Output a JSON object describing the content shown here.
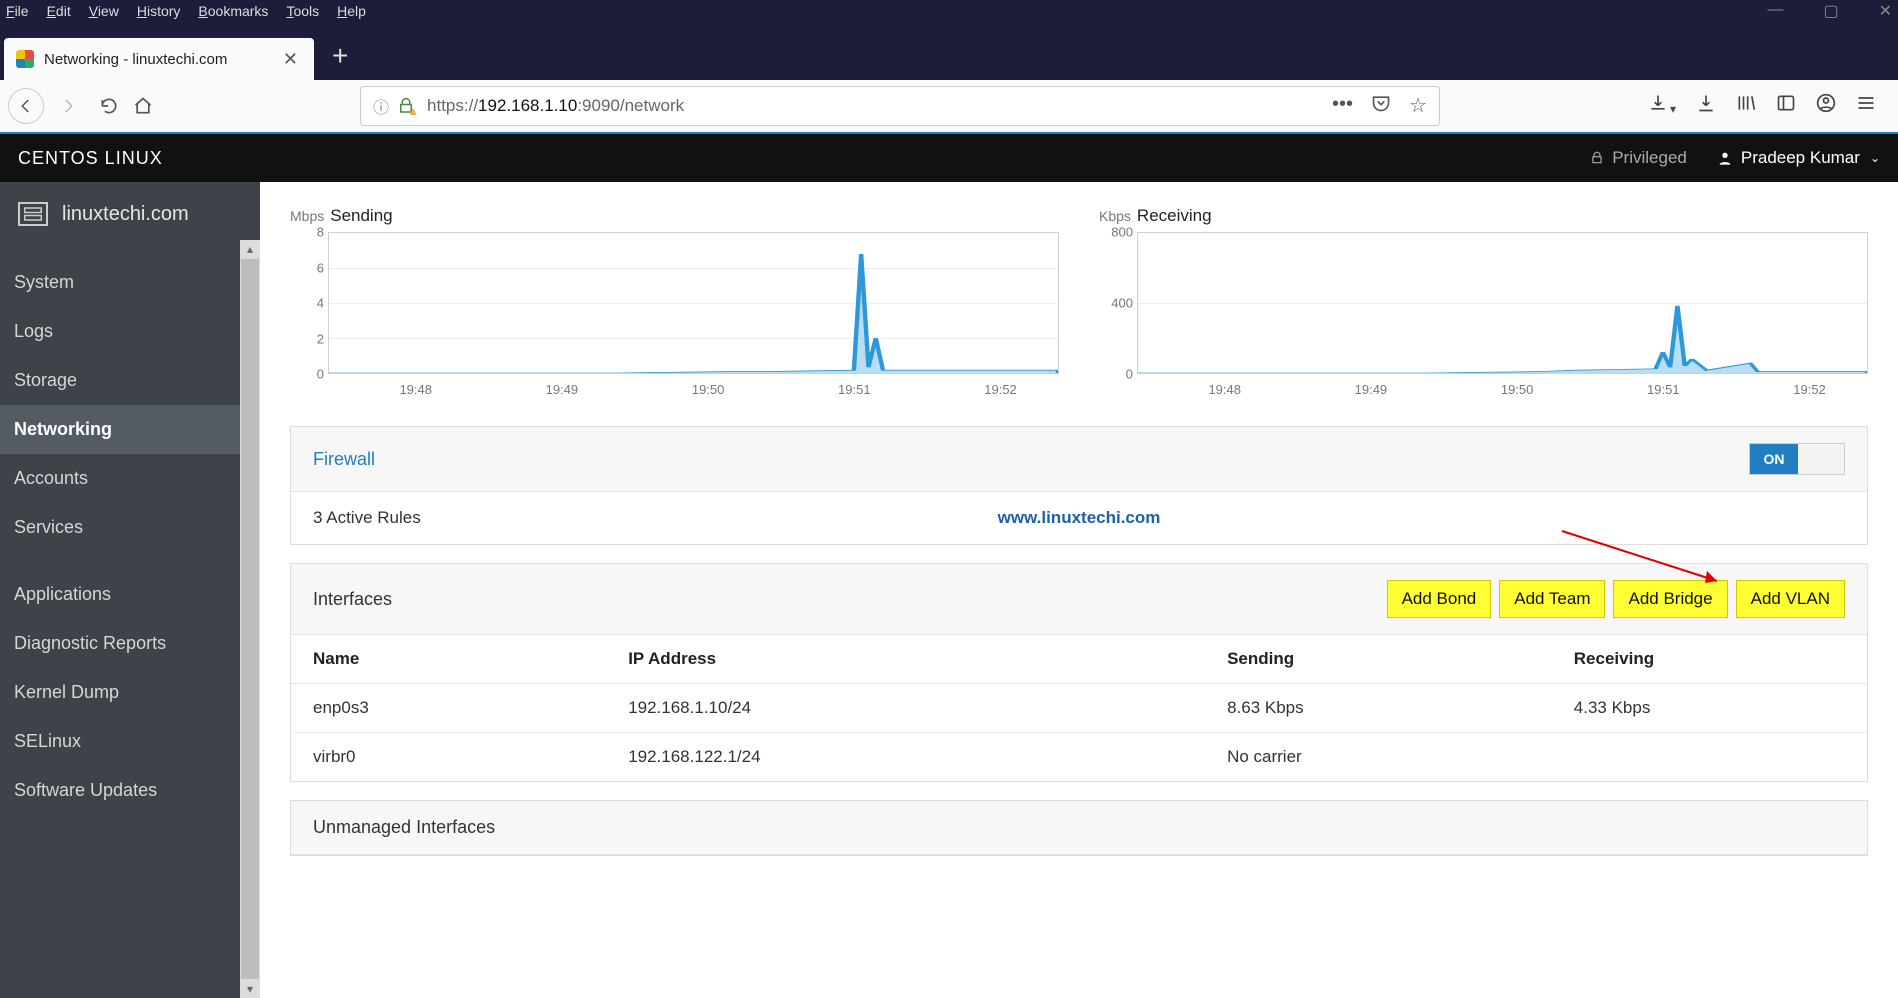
{
  "menubar": {
    "file": "File",
    "edit": "Edit",
    "view": "View",
    "history": "History",
    "bookmarks": "Bookmarks",
    "tools": "Tools",
    "help": "Help"
  },
  "tab": {
    "title": "Networking - linuxtechi.com"
  },
  "url": {
    "prefix": "https://",
    "host": "192.168.1.10",
    "suffix": ":9090/network"
  },
  "cockpit": {
    "title": "CENTOS LINUX",
    "privileged": "Privileged",
    "user": "Pradeep Kumar"
  },
  "host": {
    "name": "linuxtechi.com"
  },
  "sidebar": {
    "items": [
      "System",
      "Logs",
      "Storage",
      "Networking",
      "Accounts",
      "Services"
    ],
    "items2": [
      "Applications",
      "Diagnostic Reports",
      "Kernel Dump",
      "SELinux",
      "Software Updates"
    ],
    "active": "Networking"
  },
  "charts": {
    "sending": {
      "unit": "Mbps",
      "label": "Sending"
    },
    "receiving": {
      "unit": "Kbps",
      "label": "Receiving"
    },
    "xticks": [
      "19:48",
      "19:49",
      "19:50",
      "19:51",
      "19:52"
    ]
  },
  "firewall": {
    "label": "Firewall",
    "rules": "3 Active Rules",
    "toggle": "ON"
  },
  "watermark": "www.linuxtechi.com",
  "interfaces": {
    "title": "Interfaces",
    "buttons": {
      "bond": "Add Bond",
      "team": "Add Team",
      "bridge": "Add Bridge",
      "vlan": "Add VLAN"
    },
    "columns": {
      "name": "Name",
      "ip": "IP Address",
      "sending": "Sending",
      "receiving": "Receiving"
    },
    "rows": [
      {
        "name": "enp0s3",
        "ip": "192.168.1.10/24",
        "sending": "8.63 Kbps",
        "receiving": "4.33 Kbps"
      },
      {
        "name": "virbr0",
        "ip": "192.168.122.1/24",
        "sending": "No carrier",
        "receiving": ""
      }
    ]
  },
  "unmanaged": {
    "title": "Unmanaged Interfaces"
  },
  "chart_data": [
    {
      "type": "line",
      "title": "Sending",
      "unit": "Mbps",
      "ylim": [
        0,
        8
      ],
      "yticks": [
        0,
        2,
        4,
        6,
        8
      ],
      "xticks": [
        "19:48",
        "19:49",
        "19:50",
        "19:51",
        "19:52"
      ],
      "series": [
        {
          "name": "Sending",
          "points": [
            {
              "x": "19:48",
              "y": 0
            },
            {
              "x": "19:49",
              "y": 0
            },
            {
              "x": "19:50",
              "y": 0.1
            },
            {
              "x": "19:50.3",
              "y": 0.1
            },
            {
              "x": "19:50.9",
              "y": 0.2
            },
            {
              "x": "19:50.95",
              "y": 6.8
            },
            {
              "x": "19:51.0",
              "y": 0.3
            },
            {
              "x": "19:51.05",
              "y": 2.0
            },
            {
              "x": "19:51.1",
              "y": 0.1
            },
            {
              "x": "19:52",
              "y": 0.1
            }
          ]
        }
      ]
    },
    {
      "type": "line",
      "title": "Receiving",
      "unit": "Kbps",
      "ylim": [
        0,
        800
      ],
      "yticks": [
        0,
        400,
        800
      ],
      "xticks": [
        "19:48",
        "19:49",
        "19:50",
        "19:51",
        "19:52"
      ],
      "series": [
        {
          "name": "Receiving",
          "points": [
            {
              "x": "19:48",
              "y": 0
            },
            {
              "x": "19:49",
              "y": 0
            },
            {
              "x": "19:50",
              "y": 5
            },
            {
              "x": "19:50.3",
              "y": 10
            },
            {
              "x": "19:50.9",
              "y": 15
            },
            {
              "x": "19:50.93",
              "y": 120
            },
            {
              "x": "19:50.96",
              "y": 30
            },
            {
              "x": "19:51.0",
              "y": 380
            },
            {
              "x": "19:51.05",
              "y": 40
            },
            {
              "x": "19:51.1",
              "y": 80
            },
            {
              "x": "19:51.2",
              "y": 10
            },
            {
              "x": "19:51.6",
              "y": 50
            },
            {
              "x": "19:51.65",
              "y": 8
            },
            {
              "x": "19:52",
              "y": 8
            }
          ]
        }
      ]
    }
  ]
}
